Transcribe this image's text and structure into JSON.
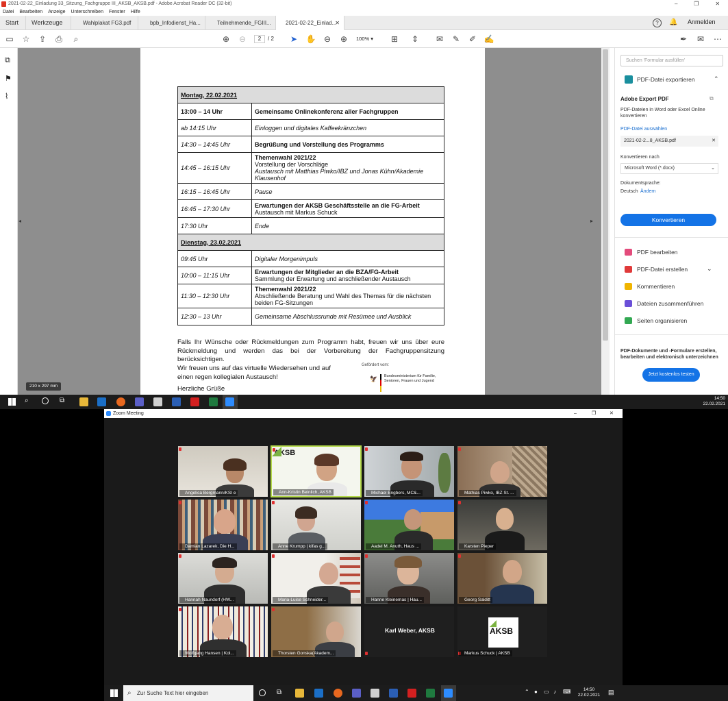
{
  "acrobat": {
    "title": "2021-02-22_Einladung 33_Sitzung_Fachgruppe III_AKSB_AKSB.pdf - Adobe Acrobat Reader DC (32-bit)",
    "menu": [
      "Datei",
      "Bearbeiten",
      "Anzeige",
      "Unterschreiben",
      "Fenster",
      "Hilfe"
    ],
    "tabs": {
      "start": "Start",
      "werkzeuge": "Werkzeuge",
      "t1": "Wahlplakat FG3.pdf",
      "t2": "bpb_Infodienst_Ha...",
      "t3": "Teilnehmende_FGIII...",
      "t4": "2021-02-22_Einlad..."
    },
    "anmelden": "Anmelden",
    "page_current": "2",
    "page_total": "/ 2",
    "zoom": "100%",
    "page_size": "210 x 297 mm",
    "schedule": {
      "day1": "Montag, 22.02.2021",
      "r1t": "13:00 – 14 Uhr",
      "r1": "Gemeinsame Onlinekonferenz aller Fachgruppen",
      "r2t": "ab 14:15 Uhr",
      "r2": "Einloggen und digitales Kaffeekränzchen",
      "r3t": "14:30 – 14:45 Uhr",
      "r3": "Begrüßung und Vorstellung des Programms",
      "r4t": "14:45 – 16:15 Uhr",
      "r4a": "Themenwahl 2021/22",
      "r4b": "Vorstellung der Vorschläge",
      "r4c": "Austausch mit Matthias Piwko/IBZ und Jonas Kühn/Akademie Klausenhof",
      "r5t": "16:15 – 16:45 Uhr",
      "r5": "Pause",
      "r6t": "16:45 – 17:30 Uhr",
      "r6a": "Erwartungen der AKSB Geschäftsstelle an die FG-Arbeit",
      "r6b": "Austausch mit Markus Schuck",
      "r7t": "17:30 Uhr",
      "r7": "Ende",
      "day2": "Dienstag, 23.02.2021",
      "s1t": "09:45 Uhr",
      "s1": "Digitaler Morgenimpuls",
      "s2t": "10:00 – 11:15 Uhr",
      "s2a": "Erwartungen der Mitglieder an die BZA/FG-Arbeit",
      "s2b": "Sammlung der Erwartung und anschließender Austausch",
      "s3t": "11:30 – 12:30 Uhr",
      "s3a": "Themenwahl 2021/22",
      "s3b": "Abschließende Beratung und Wahl des Themas für die nächsten beiden FG-Sitzungen",
      "s4t": "12:30 – 13 Uhr",
      "s4": "Gemeinsame Abschlussrunde mit Resümee und Ausblick"
    },
    "para1": "Falls Ihr Wünsche oder Rückmeldungen zum Programm habt, freuen wir uns über eure Rückmeldung und werden das bei der Vorbereitung der Fachgruppensitzung berücksichtigen.",
    "para2": "Wir freuen uns auf das virtuelle Wiedersehen und auf einen regen kollegialen Austausch!",
    "greeting": "Herzliche Grüße",
    "funded": "Gefördert vom:",
    "ministry": "Bundesministerium für Familie, Senioren, Frauen und Jugend",
    "panel": {
      "search_placeholder": "Suchen 'Formular ausfüllen'",
      "export_title": "PDF-Datei exportieren",
      "adobe_export": "Adobe Export PDF",
      "desc": "PDF-Dateien in Word oder Excel Online konvertieren",
      "select_file": "PDF-Datei auswählen",
      "file": "2021-02-2...8_AKSB.pdf",
      "convert_to": "Konvertieren nach",
      "format": "Microsoft Word (*.docx)",
      "doclang": "Dokumentsprache:",
      "lang": "Deutsch",
      "change": "Ändern",
      "convert_btn": "Konvertieren",
      "tools": [
        "PDF bearbeiten",
        "PDF-Datei erstellen",
        "Kommentieren",
        "Dateien zusammenführen",
        "Seiten organisieren"
      ],
      "promo": "PDF-Dokumente und -Formulare erstellen, bearbeiten und elektronisch unterzeichnen",
      "trial_btn": "Jetzt kostenlos testen"
    }
  },
  "taskbar_top": {
    "time": "14:50",
    "date": "22.02.2021"
  },
  "zoom": {
    "title": "Zoom Meeting",
    "participants": [
      "Angelica Bergmann/KSI e",
      "Ann-Kristin Beinlich, AKSB",
      "Michael Engbers, MC&...",
      "Mathias Piwko, IBZ St. ...",
      "Damian Lazarek, Die H...",
      "Anne Krumpp | kifas g...",
      "Aadel M. Anuth, Haus ...",
      "Karsten Pieper",
      "Hannah Naundorf (HW...",
      "Maria-Luise Schneider...",
      "Hanne Kleinemas | Hau...",
      "Georg Salditt",
      "Wolfgang Hansen | Kol...",
      "Thorsten Gonska(Akadem...",
      "Karl Weber, AKSB",
      "Markus Schuck | AKSB"
    ],
    "logo": "AKSB"
  },
  "taskbar_bottom": {
    "search": "Zur Suche Text hier eingeben",
    "time": "14:50",
    "date": "22.02.2021"
  }
}
